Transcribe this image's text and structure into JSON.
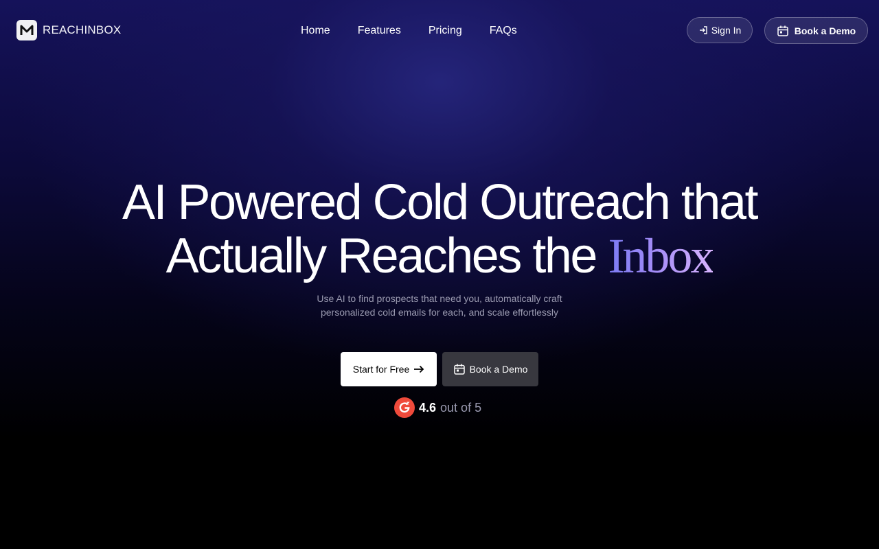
{
  "header": {
    "brand": "REACHINBOX",
    "logo_letter": "M",
    "nav": [
      "Home",
      "Features",
      "Pricing",
      "FAQs"
    ],
    "sign_in_label": "Sign In",
    "book_demo_label": "Book a Demo"
  },
  "hero": {
    "title_line1": "AI Powered Cold Outreach that",
    "title_line2_prefix": "Actually Reaches the ",
    "title_accent": "Inbox",
    "subtitle_line1": "Use AI to find prospects that need you, automatically craft",
    "subtitle_line2": "personalized cold emails for each, and scale effortlessly",
    "start_label": "Start for Free",
    "demo_label": "Book a Demo"
  },
  "rating": {
    "value": "4.6",
    "suffix": "out of 5"
  },
  "icons": {
    "sign_in": "login-icon",
    "calendar": "calendar-icon",
    "arrow": "arrow-right-icon",
    "g2": "g2-logo-icon"
  },
  "colors": {
    "accent_start": "#7b7bf3",
    "accent_end": "#d8b4fe",
    "g2_red": "#ef4a3b"
  }
}
